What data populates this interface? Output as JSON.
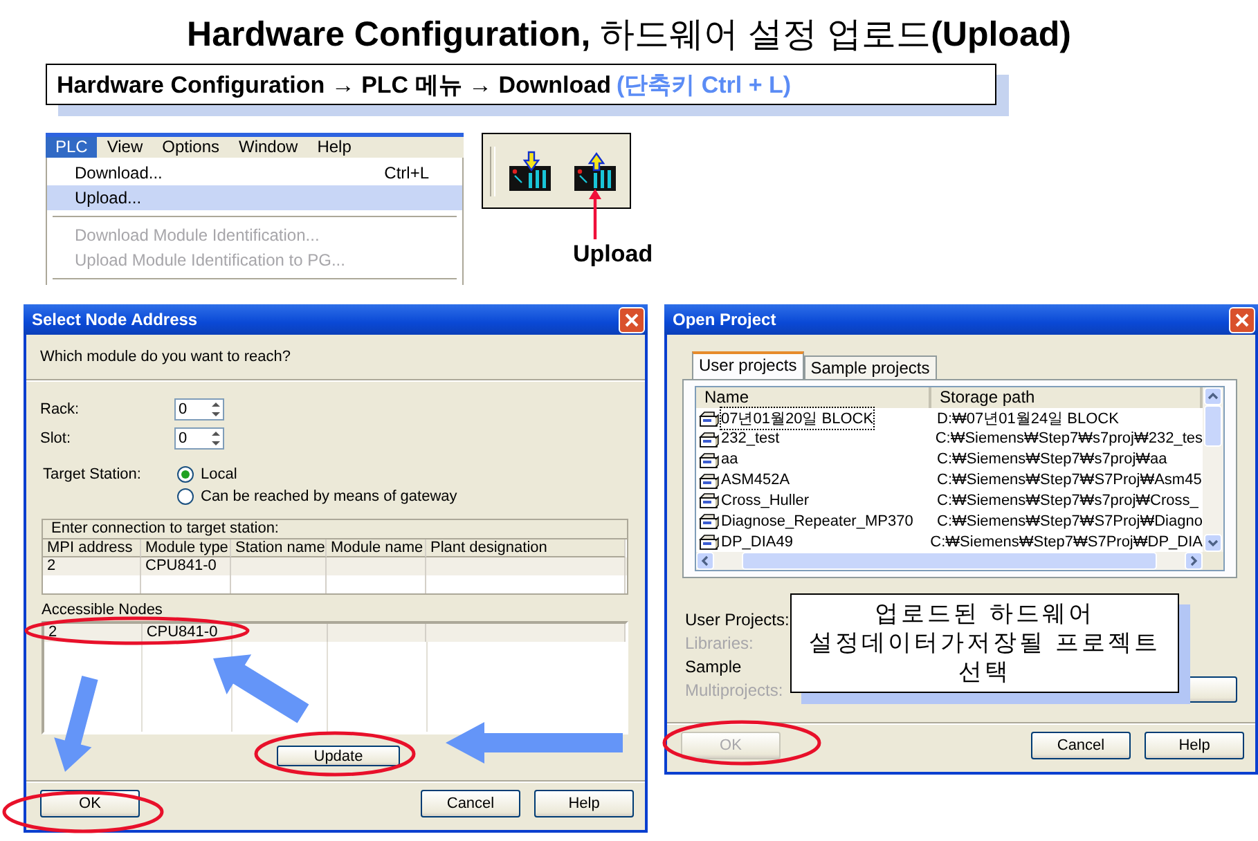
{
  "title": "**Hardware Configuration,** 하드웨어 설정 업로드**(Upload)**",
  "subtitle": {
    "path": "Hardware Configuration → PLC 메뉴 → Download",
    "shortcut": "(단축키 Ctrl + L)"
  },
  "menu": {
    "bar": [
      {
        "label": "PLC",
        "selected": true
      },
      {
        "label": "View",
        "selected": false
      },
      {
        "label": "Options",
        "selected": false
      },
      {
        "label": "Window",
        "selected": false
      },
      {
        "label": "Help",
        "selected": false
      }
    ],
    "items": [
      {
        "kind": "item",
        "label": "Download...",
        "shortcut": "Ctrl+L",
        "selected": false,
        "disabled": false
      },
      {
        "kind": "item",
        "label": "Upload...",
        "selected": true,
        "disabled": false
      },
      {
        "kind": "separator"
      },
      {
        "kind": "item",
        "label": "Download Module Identification...",
        "selected": false,
        "disabled": true
      },
      {
        "kind": "item",
        "label": "Upload Module Identification to PG...",
        "selected": false,
        "disabled": true
      },
      {
        "kind": "separator"
      }
    ]
  },
  "toolbar": {
    "callout": "Upload"
  },
  "node_dialog": {
    "title": "Select Node Address",
    "prompt": "Which module do you want to reach?",
    "fields": [
      {
        "label": "Rack:",
        "value": "0"
      },
      {
        "label": "Slot:",
        "value": "0"
      }
    ],
    "target_label": "Target Station:",
    "options": [
      {
        "label": "Local",
        "selected": true
      },
      {
        "label": "Can be reached by means of gateway",
        "selected": false
      }
    ],
    "connection": {
      "caption": "Enter connection to target station:",
      "columns": [
        "MPI address",
        "Module type",
        "Station name",
        "Module name",
        "Plant designation"
      ],
      "rows": [
        [
          "2",
          "CPU841-0",
          "",
          "",
          ""
        ]
      ]
    },
    "nodes": {
      "caption": "Accessible Nodes",
      "rows": [
        [
          "2",
          "CPU841-0",
          "",
          "",
          ""
        ]
      ]
    },
    "update_button": "Update",
    "buttons": [
      "OK",
      "Cancel",
      "Help"
    ]
  },
  "project_dialog": {
    "title": "Open Project",
    "tabs": [
      {
        "label": "User projects",
        "selected": true
      },
      {
        "label": "Sample projects",
        "selected": false
      }
    ],
    "columns": [
      "Name",
      "Storage path"
    ],
    "rows": [
      {
        "name": "07년01월20일 BLOCK",
        "path": "D:₩07년01월24일 BLOCK",
        "selected": true
      },
      {
        "name": "232_test",
        "path": "C:₩Siemens₩Step7₩s7proj₩232_tes",
        "selected": false
      },
      {
        "name": "aa",
        "path": "C:₩Siemens₩Step7₩s7proj₩aa",
        "selected": false
      },
      {
        "name": "ASM452A",
        "path": "C:₩Siemens₩Step7₩S7Proj₩Asm45",
        "selected": false
      },
      {
        "name": "Cross_Huller",
        "path": "C:₩Siemens₩Step7₩s7proj₩Cross_",
        "selected": false
      },
      {
        "name": "Diagnose_Repeater_MP370",
        "path": "C:₩Siemens₩Step7₩S7Proj₩Diagno",
        "selected": false
      },
      {
        "name": "DP_DIA49",
        "path": "C:₩Siemens₩Step7₩S7Proj₩DP_DIA",
        "selected": false
      }
    ],
    "labels": [
      {
        "label": "User Projects:",
        "disabled": false
      },
      {
        "label": "Libraries:",
        "disabled": true
      },
      {
        "label": "Sample",
        "disabled": false
      },
      {
        "label": "Multiprojects:",
        "disabled": true
      }
    ],
    "buttons": [
      {
        "label": "OK",
        "disabled": true
      },
      {
        "label": "Cancel",
        "disabled": false
      },
      {
        "label": "Help",
        "disabled": false
      }
    ]
  },
  "callout": {
    "lines": [
      "업로드된 하드웨어",
      "설정데이터가저장될 프로젝트",
      "선택"
    ]
  }
}
